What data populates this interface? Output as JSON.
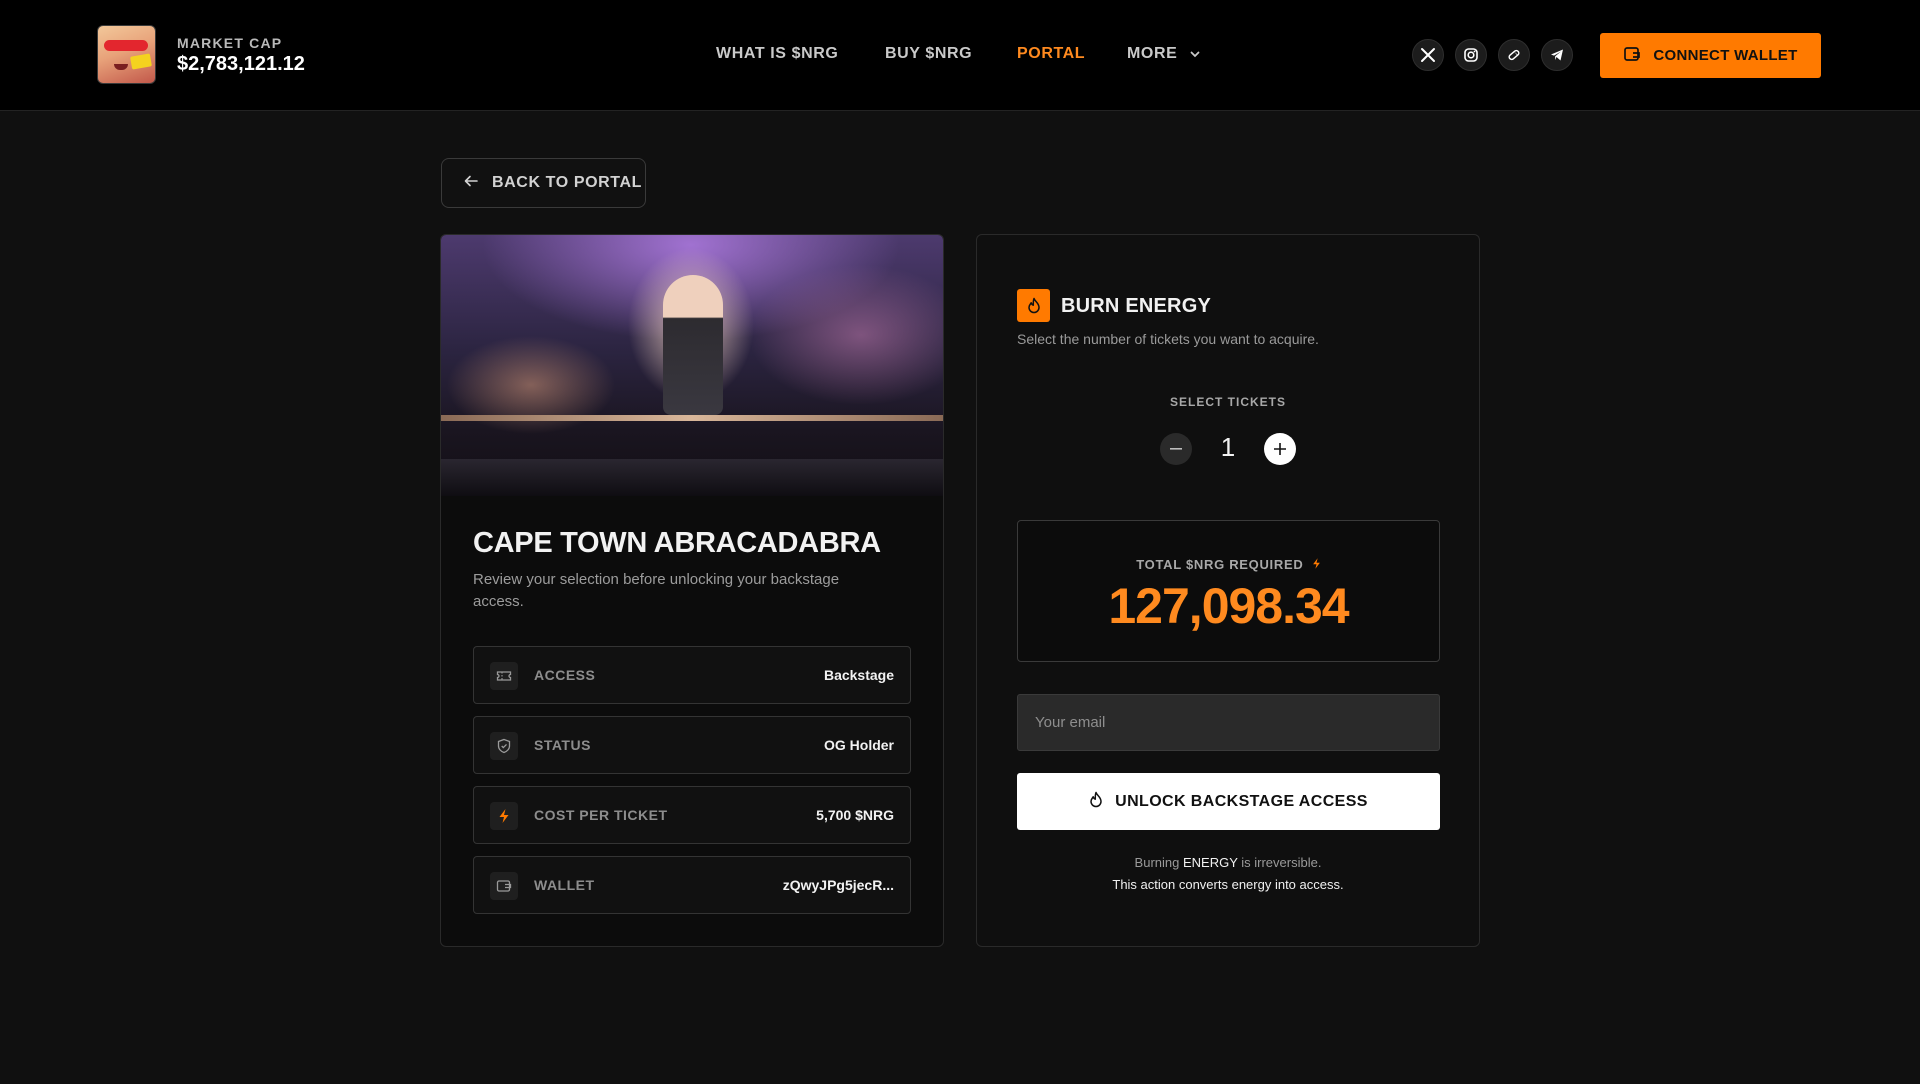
{
  "header": {
    "market_cap_label": "MARKET CAP",
    "market_cap_value": "$2,783,121.12",
    "nav": [
      {
        "label": "WHAT IS $NRG"
      },
      {
        "label": "BUY $NRG"
      },
      {
        "label": "PORTAL",
        "active": true
      },
      {
        "label": "MORE"
      }
    ],
    "socials": [
      "x-icon",
      "instagram-icon",
      "pill-icon",
      "telegram-icon"
    ],
    "connect_label": "CONNECT WALLET",
    "accent_color": "#ff7a00"
  },
  "back_label": "BACK TO PORTAL",
  "event": {
    "title": "CAPE TOWN ABRACADABRA",
    "description": "Review your selection before unlocking your backstage access.",
    "rows": [
      {
        "label": "ACCESS",
        "value": "Backstage",
        "icon": "ticket-icon"
      },
      {
        "label": "STATUS",
        "value": "OG Holder",
        "icon": "shield-icon"
      },
      {
        "label": "COST PER TICKET",
        "value": "5,700 $NRG",
        "icon": "bolt-icon"
      },
      {
        "label": "WALLET",
        "value": "zQwyJPg5jecR...",
        "icon": "wallet-icon"
      }
    ]
  },
  "burn": {
    "title": "BURN ENERGY",
    "subtitle": "Select the number of tickets you want to acquire.",
    "select_label": "SELECT TICKETS",
    "ticket_count": "1",
    "total_label": "TOTAL $NRG REQUIRED",
    "total_value": "127,098.34",
    "email_placeholder": "Your email",
    "unlock_label": "UNLOCK BACKSTAGE ACCESS",
    "disclaimer_prefix": "Burning ",
    "disclaimer_highlight": "ENERGY",
    "disclaimer_suffix": " is irreversible.",
    "disclaimer_line2": "This action converts energy into access."
  }
}
